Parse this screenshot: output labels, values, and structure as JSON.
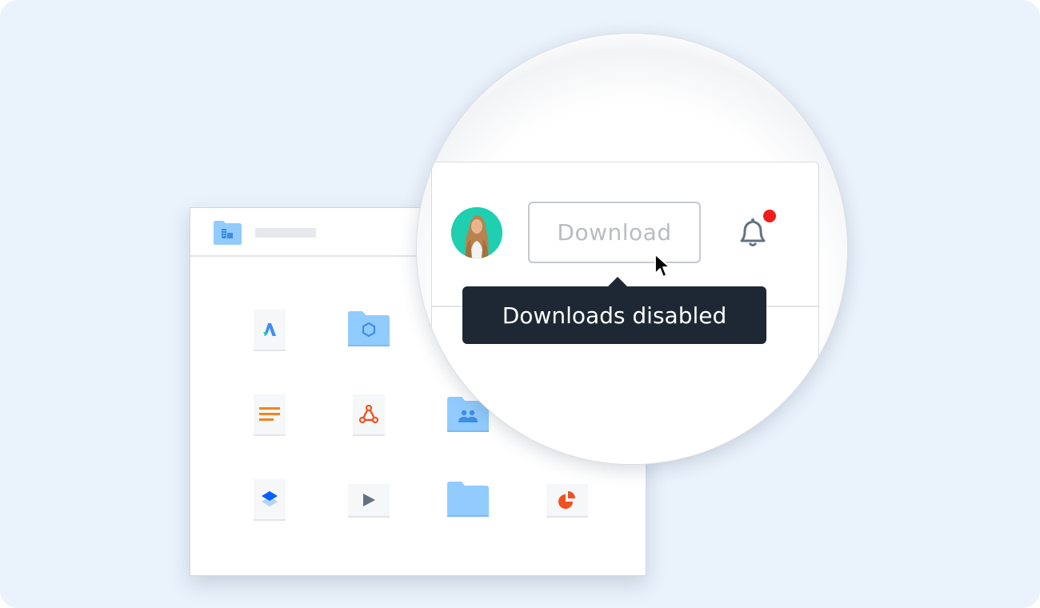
{
  "window": {
    "header": {
      "folder_icon": "team-folder-icon",
      "title_placeholder": ""
    },
    "items": [
      {
        "icon": "app-file-icon",
        "kind": "document"
      },
      {
        "icon": "package-folder-icon",
        "kind": "folder"
      },
      {
        "icon": "text-document-icon",
        "kind": "document"
      },
      {
        "icon": "pdf-acrobat-icon",
        "kind": "document"
      },
      {
        "icon": "shared-folder-icon",
        "kind": "folder"
      },
      {
        "icon": "layers-file-icon",
        "kind": "document"
      },
      {
        "icon": "video-play-icon",
        "kind": "document"
      },
      {
        "icon": "folder-icon",
        "kind": "folder"
      },
      {
        "icon": "pie-chart-file-icon",
        "kind": "document"
      }
    ]
  },
  "zoom_panel": {
    "avatar": "user-avatar",
    "download_button": {
      "label": "Download",
      "state": "disabled"
    },
    "notifications": {
      "icon": "bell-icon",
      "has_unread": true
    },
    "tooltip": {
      "text": "Downloads disabled"
    }
  },
  "colors": {
    "background": "#eaf2fb",
    "folder_blue": "#92cbfd",
    "tooltip_bg": "#1e2834",
    "badge_red": "#f01d1d",
    "avatar_teal": "#1fcfaf",
    "accent_orange": "#f5841f",
    "accent_red_orange": "#f05123"
  }
}
